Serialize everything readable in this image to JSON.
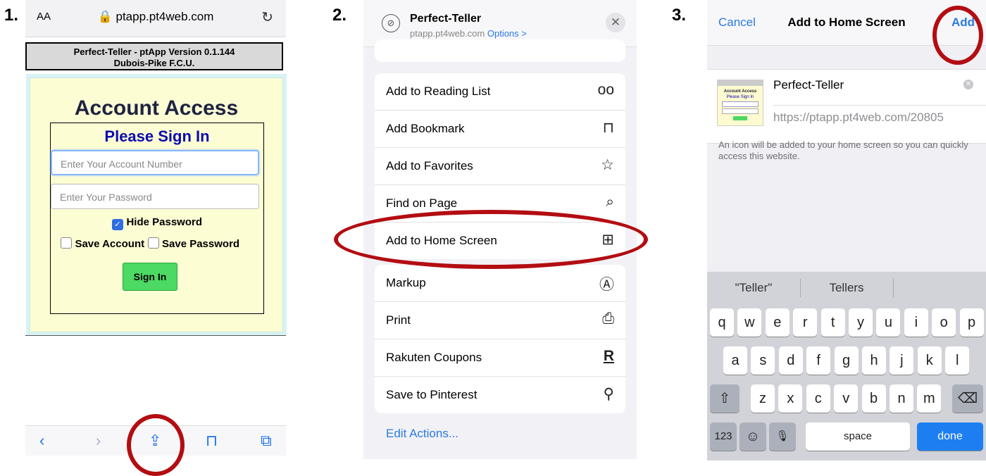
{
  "steps": {
    "s1": "1.",
    "s2": "2.",
    "s3": "3."
  },
  "panel1": {
    "aa": "AA",
    "url": "ptapp.pt4web.com",
    "site_header_line1": "Perfect-Teller - ptApp Version 0.1.144",
    "site_header_line2": "Dubois-Pike F.C.U.",
    "account_title": "Account Access",
    "sign_in_title": "Please Sign In",
    "account_placeholder": "Enter Your Account Number",
    "password_placeholder": "Enter Your Password",
    "hide_password": "Hide Password",
    "save_account": "Save Account",
    "save_password": "Save Password",
    "sign_in_button": "Sign In"
  },
  "panel2": {
    "title": "Perfect-Teller",
    "subtitle": "ptapp.pt4web.com",
    "options": "Options >",
    "group1": [
      {
        "label": "Add to Reading List",
        "icon": "oo"
      },
      {
        "label": "Add Bookmark",
        "icon": "⊓"
      },
      {
        "label": "Add to Favorites",
        "icon": "☆"
      },
      {
        "label": "Find on Page",
        "icon": "⌕"
      },
      {
        "label": "Add to Home Screen",
        "icon": "⊞"
      }
    ],
    "group2": [
      {
        "label": "Markup",
        "icon": "Ⓐ"
      },
      {
        "label": "Print",
        "icon": "⎙"
      },
      {
        "label": "Rakuten Coupons",
        "icon": "R"
      },
      {
        "label": "Save to Pinterest",
        "icon": "⚲"
      }
    ],
    "edit_actions": "Edit Actions..."
  },
  "panel3": {
    "cancel": "Cancel",
    "title": "Add to Home Screen",
    "add": "Add",
    "name": "Perfect-Teller",
    "url": "https://ptapp.pt4web.com/20805",
    "note": "An icon will be added to your home screen so you can quickly access this website.",
    "suggestions": [
      "\"Teller\"",
      "Tellers"
    ],
    "row1": [
      "q",
      "w",
      "e",
      "r",
      "t",
      "y",
      "u",
      "i",
      "o",
      "p"
    ],
    "row2": [
      "a",
      "s",
      "d",
      "f",
      "g",
      "h",
      "j",
      "k",
      "l"
    ],
    "row3": [
      "z",
      "x",
      "c",
      "v",
      "b",
      "n",
      "m"
    ],
    "num_key": "123",
    "space_key": "space",
    "done_key": "done"
  }
}
